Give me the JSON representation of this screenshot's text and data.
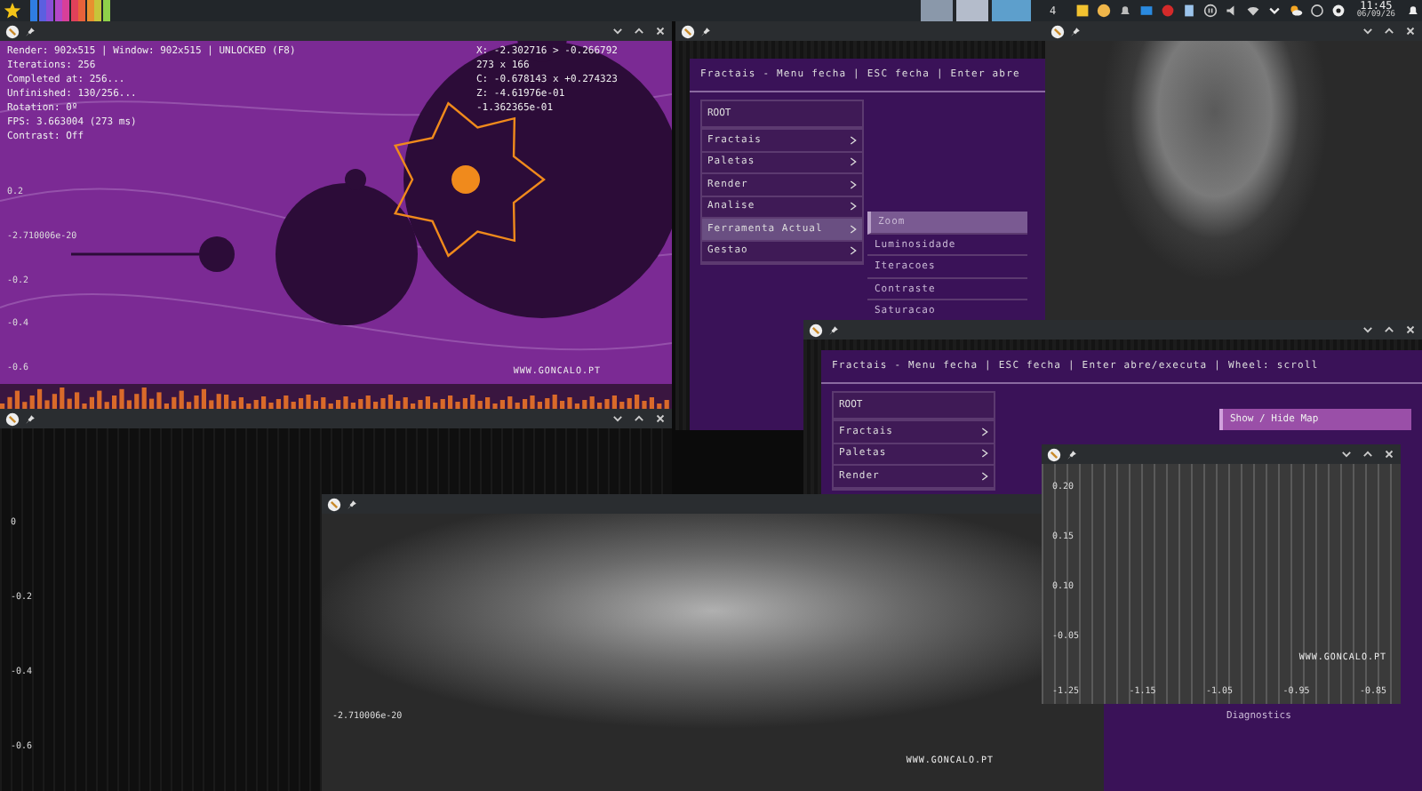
{
  "taskbar": {
    "swatches": [
      {
        "color": "#2f7de1"
      },
      {
        "color": "#5b5fe0"
      },
      {
        "color": "#8a4fd8"
      },
      {
        "color": "#b347c9"
      },
      {
        "color": "#d83f9a"
      },
      {
        "color": "#e0415a"
      },
      {
        "color": "#e8623a"
      },
      {
        "color": "#e8902f"
      },
      {
        "color": "#c7c43a"
      },
      {
        "color": "#8fd14a"
      }
    ],
    "workspace": "4",
    "clock": "11:45",
    "date": "06/09/26"
  },
  "windows": [
    {
      "kind": "mandelbrot",
      "controls": true,
      "hud_left": [
        "Render: 902x515 | Window: 902x515 | UNLOCKED (F8)",
        "Iterations: 256",
        "Completed at: 256...",
        "Unfinished: 130/256...",
        "Rotation: 0º",
        "FPS: 3.663004 (273 ms)",
        "Contrast: Off"
      ],
      "hud_right": [
        "X: -2.302716 > -0.266792",
        "273 x 166",
        "C: -0.678143 x +0.274323",
        "Z: -4.61976e-01",
        "-1.362365e-01"
      ],
      "axis_labels": [
        "0.2",
        "-2.710006e-20",
        "-0.2",
        "-0.4",
        "-0.6"
      ],
      "watermark": "WWW.GONCALO.PT"
    },
    {
      "kind": "menu",
      "controls": false,
      "header": "Fractais - Menu fecha | ESC fecha | Enter abre",
      "root": "ROOT",
      "items": [
        {
          "label": "Fractais",
          "selected": false
        },
        {
          "label": "Paletas",
          "selected": false
        },
        {
          "label": "Render",
          "selected": false
        },
        {
          "label": "Analise",
          "selected": false
        },
        {
          "label": "Ferramenta Actual",
          "selected": true
        },
        {
          "label": "Gestao",
          "selected": false
        }
      ],
      "subitems": [
        {
          "label": "Zoom",
          "selected": true
        },
        {
          "label": "Luminosidade",
          "selected": false
        },
        {
          "label": "Iteracoes",
          "selected": false
        },
        {
          "label": "Contraste",
          "selected": false
        },
        {
          "label": "Saturacao",
          "selected": false
        }
      ]
    },
    {
      "kind": "render",
      "controls": true
    },
    {
      "kind": "dark",
      "controls": true,
      "axis_labels": [
        "0",
        "-0.2",
        "-0.4",
        "-0.6"
      ]
    },
    {
      "kind": "menu",
      "controls": true,
      "header": "Fractais - Menu fecha | ESC fecha | Enter abre/executa | Wheel: scroll",
      "root": "ROOT",
      "items": [
        {
          "label": "Fractais",
          "selected": false
        },
        {
          "label": "Paletas",
          "selected": false
        },
        {
          "label": "Render",
          "selected": false
        }
      ],
      "side_items": [
        {
          "label": "Show / Hide Map",
          "selected": true
        },
        {
          "label": "Diagnostics",
          "selected": false
        }
      ]
    },
    {
      "kind": "render",
      "axis_labels": [
        "-2.710006e-20"
      ],
      "watermark": "WWW.GONCALO.PT"
    },
    {
      "kind": "minimap",
      "controls": true,
      "axis_labels": [
        "0.20",
        "0.15",
        "0.10",
        "-0.05"
      ],
      "x_labels": [
        "-1.25",
        "-1.15",
        "-1.05",
        "-0.95",
        "-0.85"
      ],
      "watermark": "WWW.GONCALO.PT"
    }
  ]
}
